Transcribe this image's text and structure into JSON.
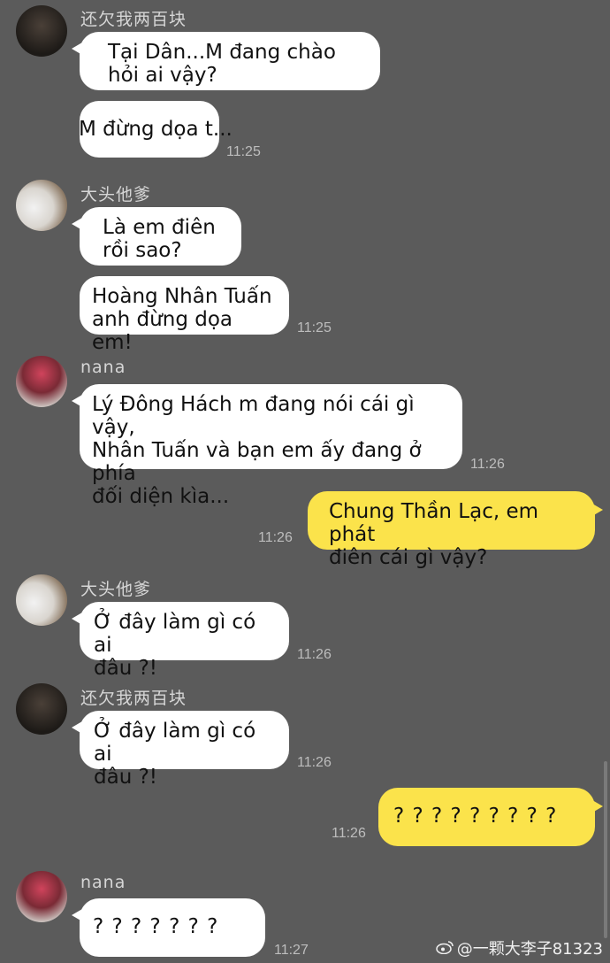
{
  "messages": [
    {
      "sender": "还欠我两百块",
      "lines": [
        "Tại Dân...M đang chào",
        "hỏi ai vậy?"
      ]
    },
    {
      "lines": [
        "M đừng dọa t..."
      ],
      "time": "11:25"
    },
    {
      "sender": "大头他爹",
      "lines": [
        "Là em điên",
        "rồi sao?"
      ]
    },
    {
      "lines": [
        "Hoàng Nhân Tuấn",
        "anh đừng dọa em!"
      ],
      "time": "11:25"
    },
    {
      "sender": "nana",
      "lines": [
        "Lý Đông Hách m đang nói cái gì vậy,",
        "Nhân Tuấn và bạn em ấy đang ở phía",
        "đối diện kìa..."
      ],
      "time": "11:26"
    },
    {
      "lines": [
        "Chung Thần Lạc, em phát",
        "điên cái gì vậy?"
      ],
      "time": "11:26"
    },
    {
      "sender": "大头他爹",
      "lines": [
        "Ở đây làm gì có ai",
        "đâu ?!"
      ],
      "time": "11:26"
    },
    {
      "sender": "还欠我两百块",
      "lines": [
        "Ở đây làm gì có ai",
        "đâu ?!"
      ],
      "time": "11:26"
    },
    {
      "lines": [
        "? ? ? ? ? ? ? ? ?"
      ],
      "time": "11:26"
    },
    {
      "sender": "nana",
      "lines": [
        "? ? ? ? ? ? ?"
      ],
      "time": "11:27"
    }
  ],
  "watermark": "@一颗大李子81323",
  "watermark_icon": "weibo-icon"
}
